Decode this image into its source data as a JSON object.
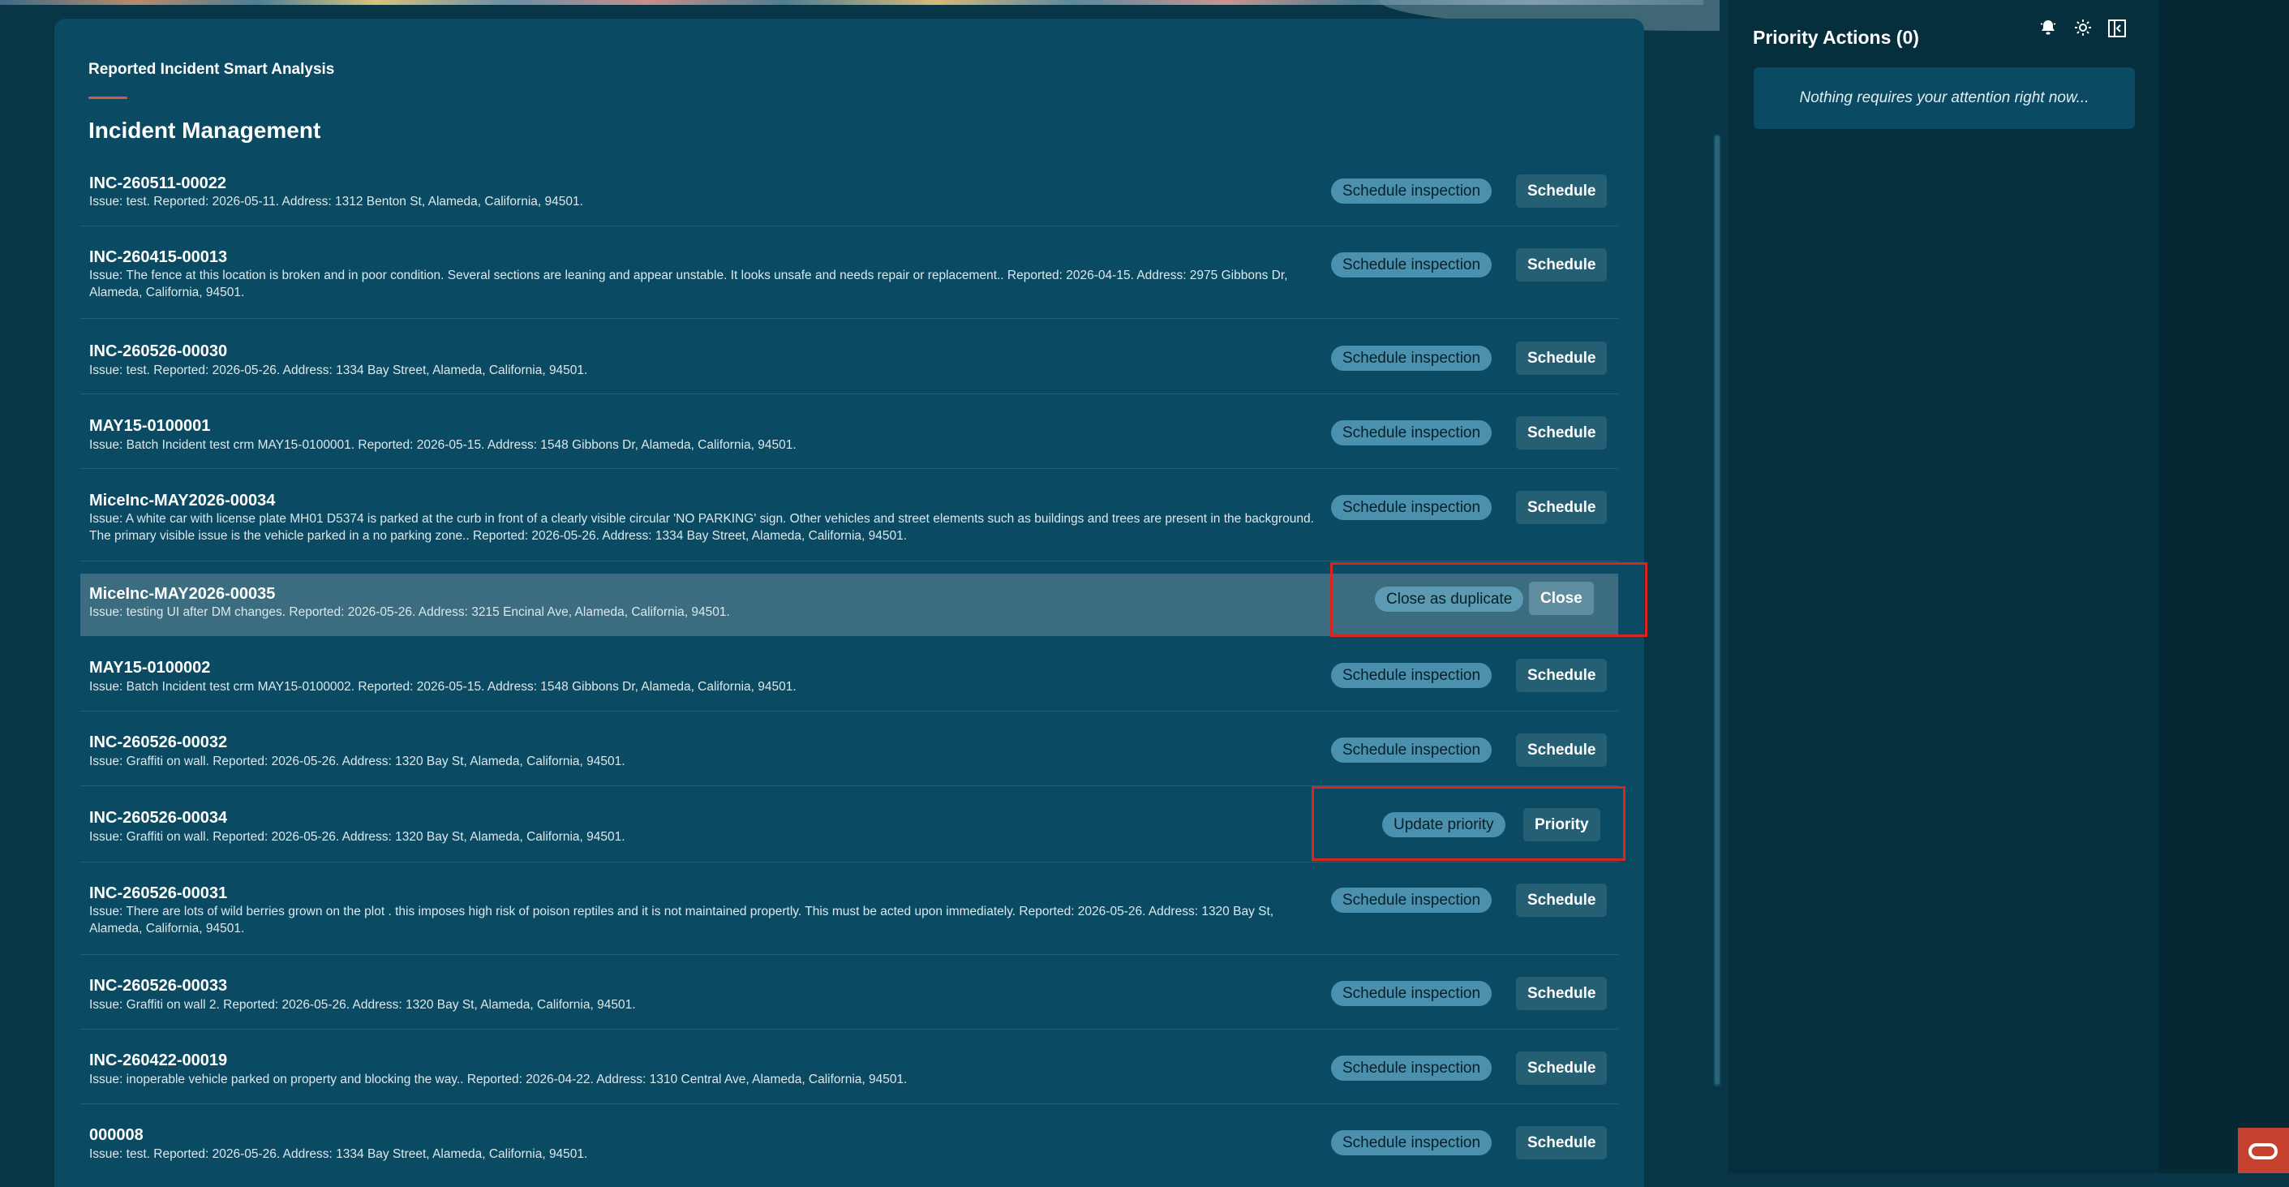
{
  "breadcrumb": "Reported Incident Smart Analysis",
  "page_title": "Incident Management",
  "rows": [
    {
      "id": "INC-260511-00022",
      "issue": "Issue: test. Reported: 2026-05-11. Address: 1312 Benton St, Alameda, California, 94501.",
      "action": "Schedule inspection",
      "button": "Schedule"
    },
    {
      "id": "INC-260415-00013",
      "issue": "Issue: The fence at this location is broken and in poor condition. Several sections are leaning and appear unstable. It looks unsafe and needs repair or replacement.. Reported: 2026-04-15. Address: 2975 Gibbons Dr, Alameda, California, 94501.",
      "action": "Schedule inspection",
      "button": "Schedule"
    },
    {
      "id": "INC-260526-00030",
      "issue": "Issue: test. Reported: 2026-05-26. Address: 1334 Bay Street, Alameda, California, 94501.",
      "action": "Schedule inspection",
      "button": "Schedule"
    },
    {
      "id": "MAY15-0100001",
      "issue": "Issue: Batch Incident test crm MAY15-0100001. Reported: 2026-05-15. Address: 1548 Gibbons Dr, Alameda, California, 94501.",
      "action": "Schedule inspection",
      "button": "Schedule"
    },
    {
      "id": "MiceInc-MAY2026-00034",
      "issue": "Issue: A white car with license plate MH01 D5374 is parked at the curb in front of a clearly visible circular 'NO PARKING' sign. Other vehicles and street elements such as buildings and trees are present in the background. The primary visible issue is the vehicle parked in a no parking zone.. Reported: 2026-05-26. Address: 1334 Bay Street, Alameda, California, 94501.",
      "action": "Schedule inspection",
      "button": "Schedule"
    },
    {
      "id": "MiceInc-MAY2026-00035",
      "issue": "Issue: testing UI after DM changes. Reported: 2026-05-26. Address: 3215 Encinal Ave, Alameda, California, 94501.",
      "action": "Close as duplicate",
      "button": "Close"
    },
    {
      "id": "MAY15-0100002",
      "issue": "Issue: Batch Incident test crm MAY15-0100002. Reported: 2026-05-15. Address: 1548 Gibbons Dr, Alameda, California, 94501.",
      "action": "Schedule inspection",
      "button": "Schedule"
    },
    {
      "id": "INC-260526-00032",
      "issue": "Issue: Graffiti on wall. Reported: 2026-05-26. Address: 1320 Bay St, Alameda, California, 94501.",
      "action": "Schedule inspection",
      "button": "Schedule"
    },
    {
      "id": "INC-260526-00034",
      "issue": "Issue: Graffiti on wall. Reported: 2026-05-26. Address: 1320 Bay St, Alameda, California, 94501.",
      "action": "Update priority",
      "button": "Priority"
    },
    {
      "id": "INC-260526-00031",
      "issue": "Issue: There are lots of wild berries grown on the plot . this imposes high risk of poison reptiles and it is not maintained propertly. This must be acted upon immediately. Reported: 2026-05-26. Address: 1320 Bay St, Alameda, California, 94501.",
      "action": "Schedule inspection",
      "button": "Schedule"
    },
    {
      "id": "INC-260526-00033",
      "issue": "Issue: Graffiti on wall 2. Reported: 2026-05-26. Address: 1320 Bay St, Alameda, California, 94501.",
      "action": "Schedule inspection",
      "button": "Schedule"
    },
    {
      "id": "INC-260422-00019",
      "issue": "Issue: inoperable vehicle parked on property and blocking the way.. Reported: 2026-04-22. Address: 1310 Central Ave, Alameda, California, 94501.",
      "action": "Schedule inspection",
      "button": "Schedule"
    },
    {
      "id": "000008",
      "issue": "Issue: test. Reported: 2026-05-26. Address: 1334 Bay Street, Alameda, California, 94501.",
      "action": "Schedule inspection",
      "button": "Schedule"
    }
  ],
  "right_panel": {
    "title": "Priority Actions (0)",
    "empty_message": "Nothing requires your attention right now...",
    "icons": [
      "notification-icon",
      "brightness-icon",
      "collapse-panel-icon"
    ]
  },
  "colors": {
    "background": "#083646",
    "panel": "#0a4a62",
    "selected_row": "#3b6c80",
    "pill_button": "#4b91ad",
    "highlight": "#d7261e",
    "oracle_red": "#c7412f"
  }
}
